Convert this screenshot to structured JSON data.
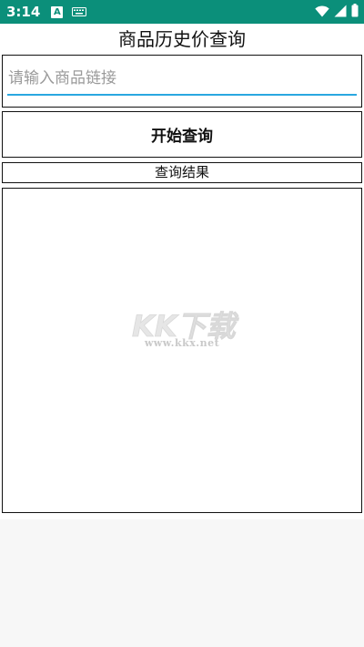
{
  "status_bar": {
    "time": "3:14",
    "notification_letter": "A",
    "icons": [
      "keyboard-icon",
      "wifi-icon",
      "signal-icon",
      "battery-icon"
    ]
  },
  "page": {
    "title": "商品历史价查询"
  },
  "search": {
    "placeholder": "请输入商品链接",
    "value": ""
  },
  "query_button": {
    "label": "开始查询"
  },
  "results": {
    "label": "查询结果",
    "content": ""
  },
  "watermark": {
    "logo_text": "KK下载",
    "url": "www.kkx.net"
  },
  "colors": {
    "status_bar": "#0b8f7a",
    "input_underline": "#2aa7e0",
    "border": "#111111",
    "background": "#f7f7f7"
  }
}
